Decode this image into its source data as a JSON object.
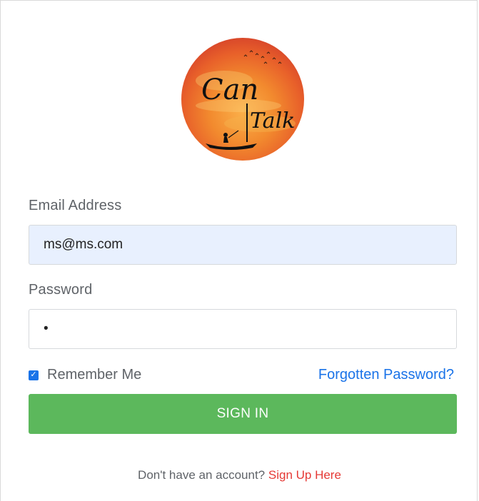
{
  "logo": {
    "line1": "Can",
    "line2": "Talk"
  },
  "form": {
    "email_label": "Email Address",
    "email_value": "ms@ms.com",
    "password_label": "Password",
    "password_value": "•",
    "remember_label": "Remember Me",
    "remember_checked": true,
    "forgot_link": "Forgotten Password?",
    "signin_button": "SIGN IN"
  },
  "footer": {
    "prompt": "Don't have an account?",
    "signup_link": "Sign Up Here"
  },
  "colors": {
    "primary_blue": "#1a73e8",
    "success_green": "#5cb85c",
    "link_red": "#e53935",
    "autofill_bg": "#e8f0fe"
  }
}
